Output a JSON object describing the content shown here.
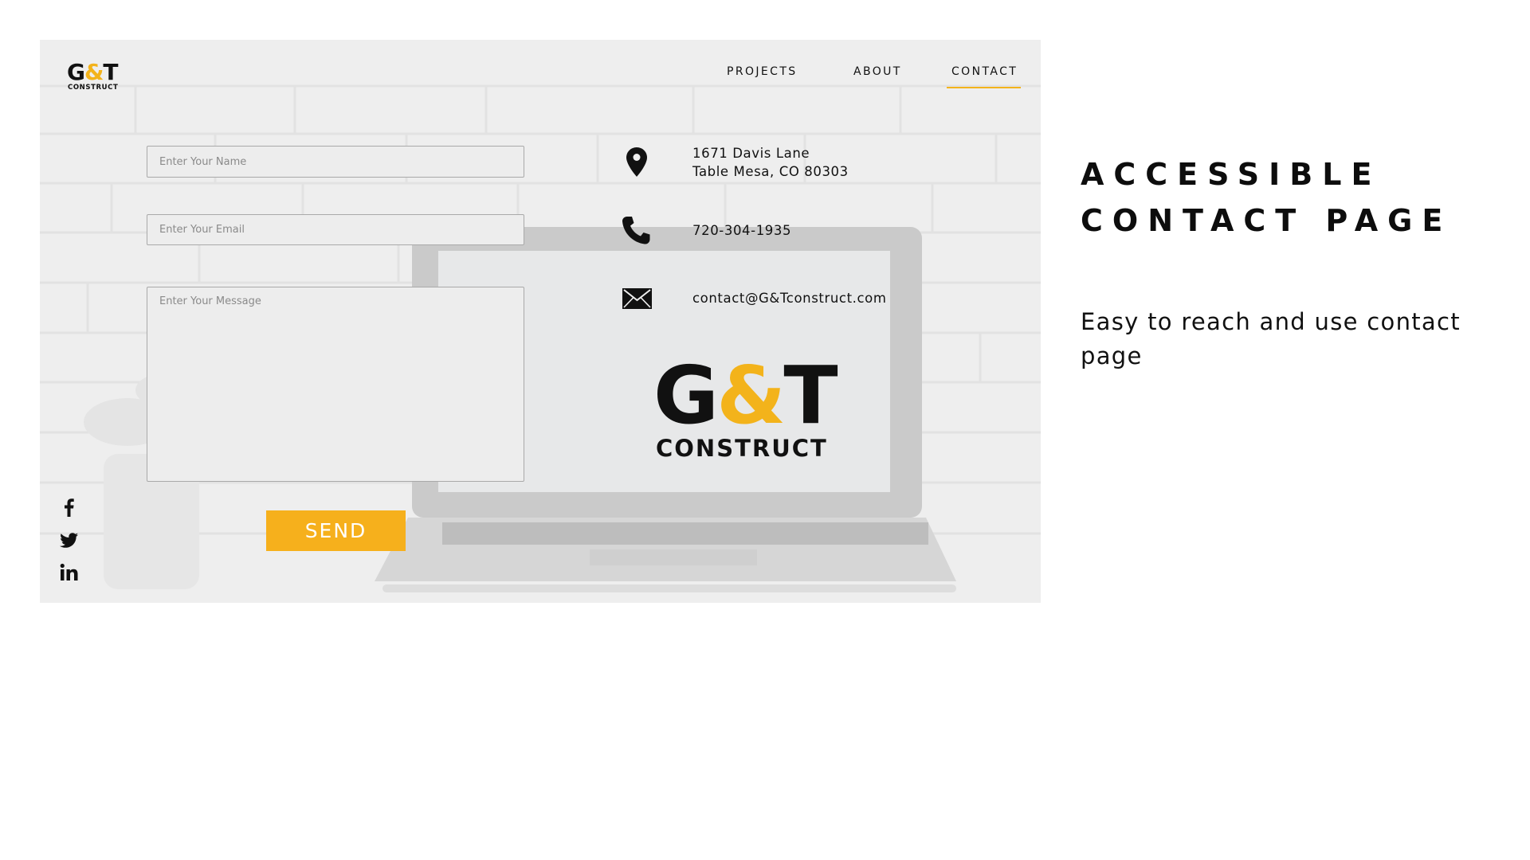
{
  "brand": {
    "name_left": "G",
    "ampersand": "&",
    "name_right": "T",
    "tagline": "CONSTRUCT",
    "accent_color": "#f3b31b"
  },
  "nav": {
    "items": [
      {
        "label": "PROJECTS",
        "active": false
      },
      {
        "label": "ABOUT",
        "active": false
      },
      {
        "label": "CONTACT",
        "active": true
      }
    ]
  },
  "form": {
    "name_placeholder": "Enter Your Name",
    "email_placeholder": "Enter Your Email",
    "message_placeholder": "Enter Your Message",
    "send_label": "SEND",
    "button_color": "#f6b01c"
  },
  "contact": {
    "address_line1": "1671 Davis Lane",
    "address_line2": "Table Mesa, CO 80303",
    "phone": "720-304-1935",
    "email": "contact@G&Tconstruct.com",
    "icons": [
      "location-pin-icon",
      "phone-icon",
      "envelope-icon"
    ]
  },
  "social": {
    "icons": [
      "facebook-icon",
      "twitter-icon",
      "linkedin-icon"
    ]
  },
  "caption": {
    "heading_line1": "ACCESSIBLE",
    "heading_line2": "CONTACT PAGE",
    "description": "Easy to reach and use contact page"
  }
}
